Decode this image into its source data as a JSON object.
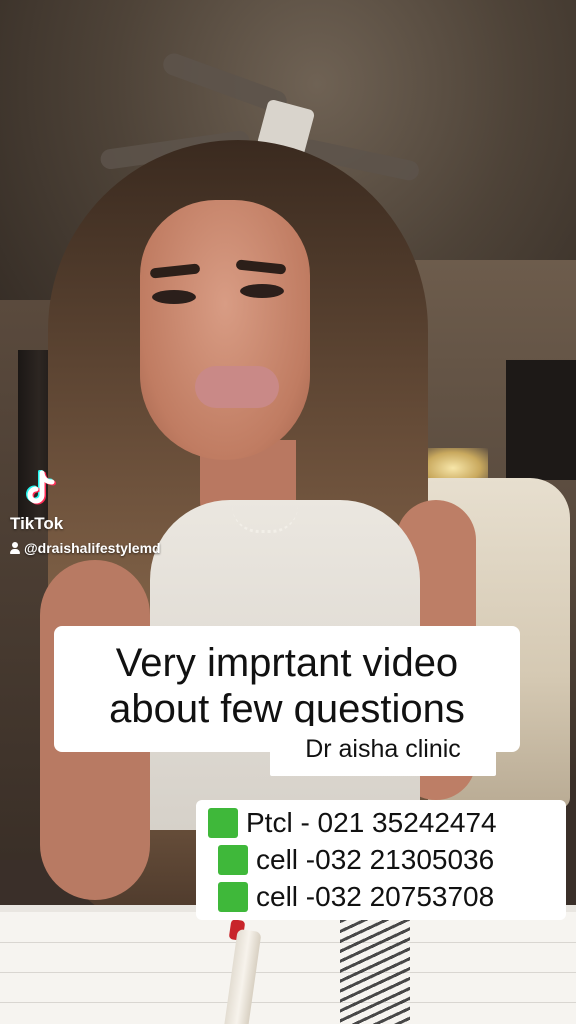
{
  "watermark": {
    "brand": "TikTok",
    "handle": "@draishalifestylemd",
    "logo_icon": "tiktok-logo-icon",
    "user_icon": "user-icon"
  },
  "caption": {
    "line1": "Very imprtant video",
    "line2": "about few questions"
  },
  "clinic_label": "Dr aisha clinic",
  "contacts": [
    {
      "icon": "green-square-icon",
      "text": "Ptcl - 021 35242474"
    },
    {
      "icon": "green-square-icon",
      "text": "cell -032 21305036"
    },
    {
      "icon": "green-square-icon",
      "text": "cell -032 20753708"
    }
  ],
  "colors": {
    "caption_bg": "#ffffff",
    "caption_text": "#111111",
    "emoji_green": "#3fb83a",
    "tiktok_cyan": "#25f4ee",
    "tiktok_red": "#fe2c55"
  }
}
